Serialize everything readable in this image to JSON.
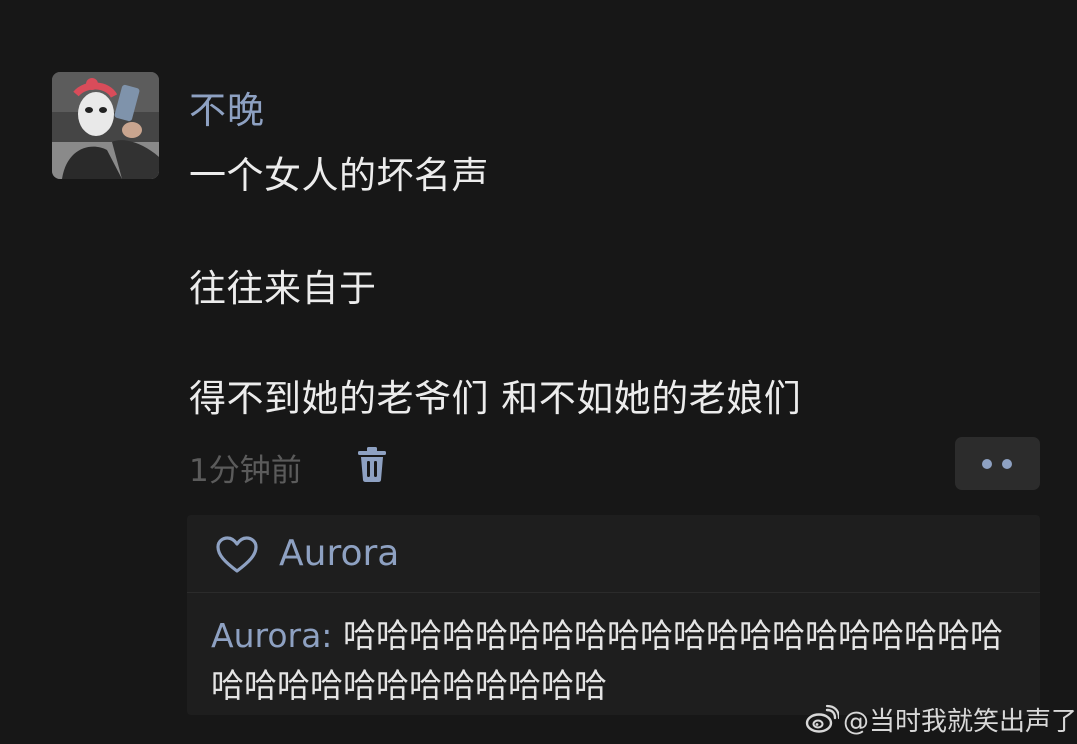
{
  "post": {
    "username": "不晚",
    "lines": [
      "一个女人的坏名声",
      "往往来自于",
      "得不到她的老爷们 和不如她的老娘们"
    ],
    "time": "1分钟前"
  },
  "interactions": {
    "like_names": "Aurora",
    "comment_author": "Aurora:",
    "comment_text": "哈哈哈哈哈哈哈哈哈哈哈哈哈哈哈哈哈哈哈哈哈哈哈哈哈哈哈哈哈哈哈哈"
  },
  "watermark": {
    "text": "@当时我就笑出声了",
    "logo": "weibo-logo"
  },
  "icons": {
    "delete": "trash-icon",
    "more": "more-dots-icon",
    "like": "heart-outline-icon"
  },
  "colors": {
    "background": "#171717",
    "accent": "#8ea1c2",
    "text": "#ececec",
    "muted": "#5b5b5b",
    "panel": "#1e1e1e"
  }
}
